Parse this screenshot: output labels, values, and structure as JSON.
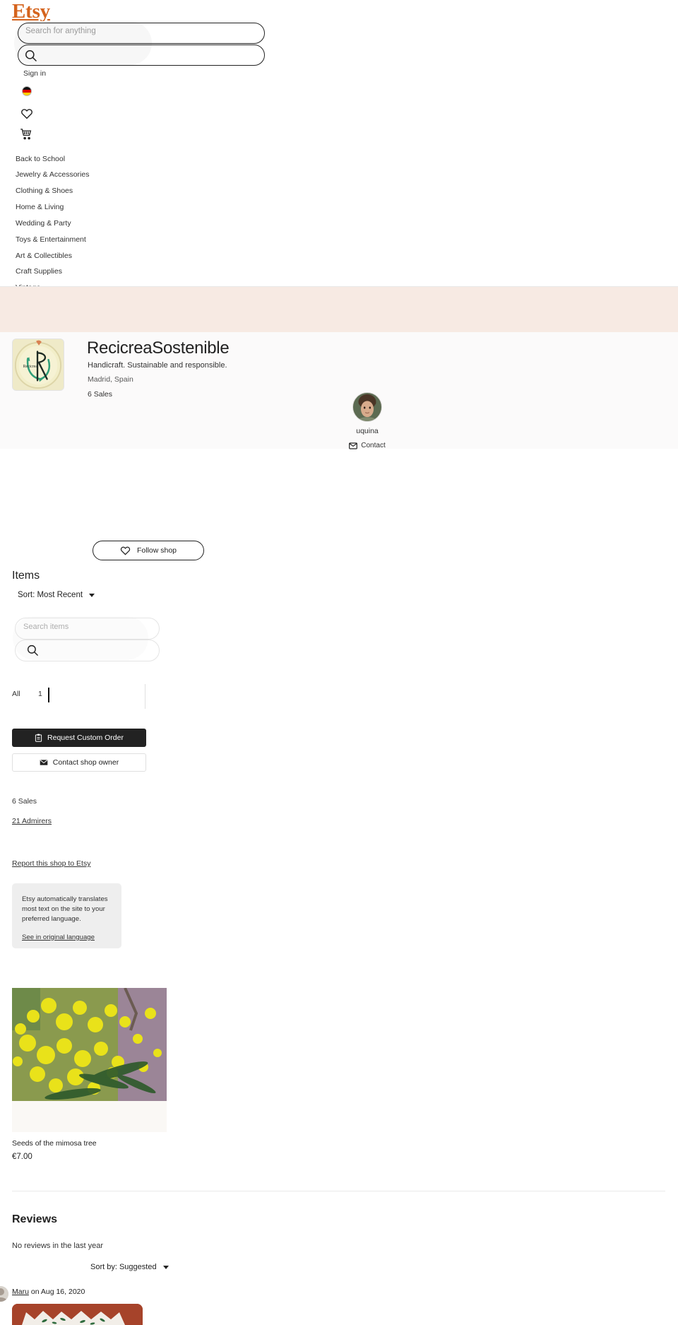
{
  "brand": {
    "logo_text": "Etsy",
    "logo_color": "#D5641E"
  },
  "header": {
    "search_placeholder": "Search for anything",
    "search_value": "",
    "search_icon": "search-icon",
    "sign_in_label": "Sign in",
    "locale_flag": "germany-flag-icon",
    "favorites_icon": "heart-icon",
    "cart_icon": "shopping-cart-icon",
    "nav_items": [
      {
        "label": "Back to School"
      },
      {
        "label": "Jewelry & Accessories"
      },
      {
        "label": "Clothing & Shoes"
      },
      {
        "label": "Home & Living"
      },
      {
        "label": "Wedding & Party"
      },
      {
        "label": "Toys & Entertainment"
      },
      {
        "label": "Art & Collectibles"
      },
      {
        "label": "Craft Supplies"
      },
      {
        "label": "Vintage"
      }
    ]
  },
  "banner": {
    "color": "#F7EAE3"
  },
  "shop": {
    "name": "RecicreaSostenible",
    "tagline": "Handicraft. Sustainable and responsible.",
    "location": "Madrid, Spain",
    "sales_top": "6 Sales",
    "logo_alt": "recicrea-embroidery-hoop-logo",
    "owner": {
      "name": "uquina",
      "contact_label": "Contact",
      "contact_icon": "envelope-icon",
      "avatar_alt": "shop-owner-portrait"
    },
    "follow_label": "Follow shop",
    "follow_icon": "heart-icon"
  },
  "items": {
    "heading": "Items",
    "sort_label": "Sort: Most Recent",
    "sort_caret": "chevron-down-icon",
    "search_placeholder": "Search items",
    "search_value": "",
    "search_icon": "search-icon",
    "filter_all_label": "All",
    "filter_all_count": "1"
  },
  "actions": {
    "custom_order_label": "Request Custom Order",
    "custom_order_icon": "clipboard-icon",
    "contact_owner_label": "Contact shop owner",
    "contact_owner_icon": "envelope-icon"
  },
  "stats": {
    "sales": "6 Sales",
    "admirers": "21 Admirers",
    "report_label": "Report this shop to Etsy"
  },
  "translation": {
    "body": "Etsy automatically translates most text on the site to your preferred language.",
    "link_label": "See in original language"
  },
  "listings": [
    {
      "title": "Seeds of the mimosa tree",
      "price": "€7.00",
      "image_alt": "yellow-mimosa-blossom-photo"
    }
  ],
  "reviews": {
    "heading": "Reviews",
    "empty_text": "No reviews in the last year",
    "sort_label": "Sort by: Suggested",
    "sort_caret": "chevron-down-icon",
    "entries": [
      {
        "author": "Maru",
        "meta_suffix": " on Aug 16, 2020",
        "photo_alt": "terracotta-dish-with-white-cloth-photo"
      }
    ]
  }
}
